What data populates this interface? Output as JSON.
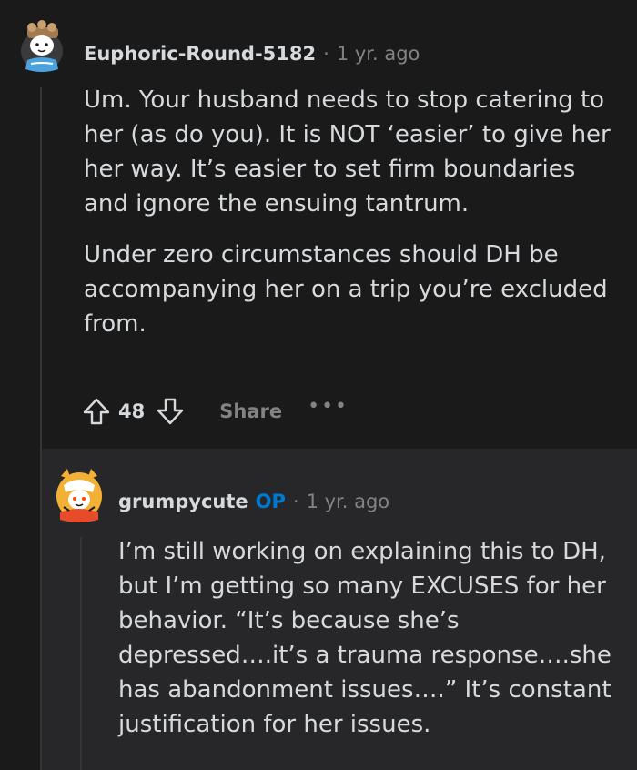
{
  "comment": {
    "username": "Euphoric-Round-5182",
    "separator": "·",
    "time": "1 yr. ago",
    "paragraphs": [
      "Um. Your husband needs to stop catering to her (as do you). It is NOT ‘easier’ to give her her way. It’s easier to set firm boundaries and ignore the ensuing tantrum.",
      "Under zero circumstances should DH be accompanying her on a trip you’re excluded from."
    ],
    "score": "48",
    "share_label": "Share",
    "more_label": "•••"
  },
  "reply": {
    "username": "grumpycute",
    "op_badge": "OP",
    "separator": "·",
    "time": "1 yr. ago",
    "text": "I’m still working on explaining this to DH, but I’m getting so many EXCUSES for her behavior. “It’s because she’s depressed….it’s a trauma response….she has abandonment issues….” It’s constant justification for her issues."
  },
  "colors": {
    "background": "#1a1a1b",
    "reply_background": "#272729",
    "text": "#d7dadc",
    "muted": "#818384",
    "op_blue": "#0079d3"
  }
}
